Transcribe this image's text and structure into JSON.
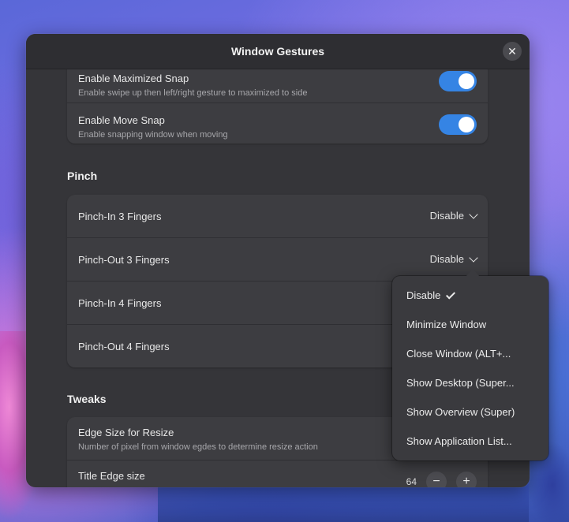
{
  "window": {
    "title": "Window Gestures"
  },
  "snap_group": {
    "items": [
      {
        "title": "Enable Maximized Snap",
        "subtitle": "Enable swipe up then left/right gesture to maximized to side",
        "enabled": true
      },
      {
        "title": "Enable Move Snap",
        "subtitle": "Enable snapping window when moving",
        "enabled": true
      }
    ]
  },
  "pinch": {
    "heading": "Pinch",
    "items": [
      {
        "title": "Pinch-In 3 Fingers",
        "value": "Disable"
      },
      {
        "title": "Pinch-Out 3 Fingers",
        "value": "Disable"
      },
      {
        "title": "Pinch-In 4 Fingers",
        "value": ""
      },
      {
        "title": "Pinch-Out 4 Fingers",
        "value": ""
      }
    ]
  },
  "tweaks": {
    "heading": "Tweaks",
    "items": [
      {
        "title": "Edge Size for Resize",
        "subtitle": "Number of pixel from window egdes to determine resize action"
      },
      {
        "title": "Title Edge size",
        "value": "64"
      }
    ]
  },
  "popover": {
    "options": [
      {
        "label": "Disable",
        "selected": true
      },
      {
        "label": "Minimize Window"
      },
      {
        "label": "Close Window (ALT+..."
      },
      {
        "label": "Show Desktop (Super..."
      },
      {
        "label": "Show Overview (Super)"
      },
      {
        "label": "Show Application List..."
      }
    ]
  },
  "colors": {
    "accent": "#3584e4",
    "window_bg": "#353539",
    "row_bg": "#3d3d41"
  }
}
